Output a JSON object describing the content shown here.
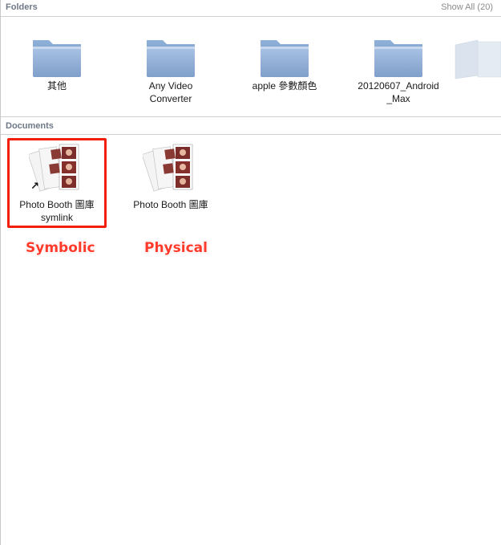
{
  "folders_section": {
    "title": "Folders",
    "show_all": "Show All (20)",
    "items": [
      {
        "label_line1": "其他",
        "label_line2": ""
      },
      {
        "label_line1": "Any Video",
        "label_line2": "Converter"
      },
      {
        "label_line1": "apple 參數顏色",
        "label_line2": ""
      },
      {
        "label_line1": "20120607_Android",
        "label_line2": "_Max"
      }
    ]
  },
  "documents_section": {
    "title": "Documents",
    "items": [
      {
        "label_line1": "Photo Booth 圖庫",
        "label_line2": "symlink"
      },
      {
        "label_line1": "Photo Booth 圖庫",
        "label_line2": ""
      }
    ]
  },
  "annotations": {
    "symbolic": "Symbolic",
    "physical": "Physical"
  },
  "colors": {
    "folder_blue": "#8fb0d8",
    "highlight_red": "#f11f0c"
  },
  "icons": {
    "folder": "folder-icon",
    "photo_booth_library": "photo-booth-library-icon",
    "alias": "alias-arrow-icon"
  }
}
